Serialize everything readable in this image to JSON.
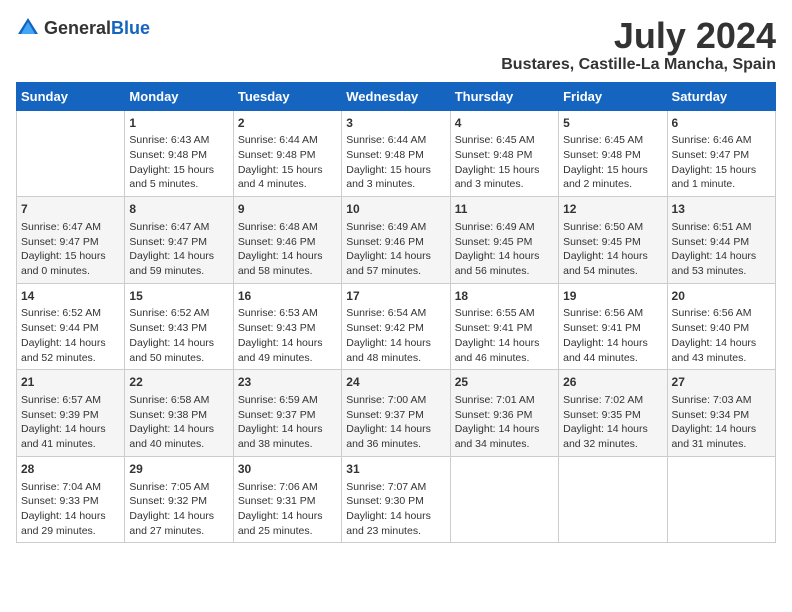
{
  "header": {
    "logo_general": "General",
    "logo_blue": "Blue",
    "month_year": "July 2024",
    "location": "Bustares, Castille-La Mancha, Spain"
  },
  "weekdays": [
    "Sunday",
    "Monday",
    "Tuesday",
    "Wednesday",
    "Thursday",
    "Friday",
    "Saturday"
  ],
  "weeks": [
    [
      {
        "day": "",
        "sunrise": "",
        "sunset": "",
        "daylight": ""
      },
      {
        "day": "1",
        "sunrise": "Sunrise: 6:43 AM",
        "sunset": "Sunset: 9:48 PM",
        "daylight": "Daylight: 15 hours and 5 minutes."
      },
      {
        "day": "2",
        "sunrise": "Sunrise: 6:44 AM",
        "sunset": "Sunset: 9:48 PM",
        "daylight": "Daylight: 15 hours and 4 minutes."
      },
      {
        "day": "3",
        "sunrise": "Sunrise: 6:44 AM",
        "sunset": "Sunset: 9:48 PM",
        "daylight": "Daylight: 15 hours and 3 minutes."
      },
      {
        "day": "4",
        "sunrise": "Sunrise: 6:45 AM",
        "sunset": "Sunset: 9:48 PM",
        "daylight": "Daylight: 15 hours and 3 minutes."
      },
      {
        "day": "5",
        "sunrise": "Sunrise: 6:45 AM",
        "sunset": "Sunset: 9:48 PM",
        "daylight": "Daylight: 15 hours and 2 minutes."
      },
      {
        "day": "6",
        "sunrise": "Sunrise: 6:46 AM",
        "sunset": "Sunset: 9:47 PM",
        "daylight": "Daylight: 15 hours and 1 minute."
      }
    ],
    [
      {
        "day": "7",
        "sunrise": "Sunrise: 6:47 AM",
        "sunset": "Sunset: 9:47 PM",
        "daylight": "Daylight: 15 hours and 0 minutes."
      },
      {
        "day": "8",
        "sunrise": "Sunrise: 6:47 AM",
        "sunset": "Sunset: 9:47 PM",
        "daylight": "Daylight: 14 hours and 59 minutes."
      },
      {
        "day": "9",
        "sunrise": "Sunrise: 6:48 AM",
        "sunset": "Sunset: 9:46 PM",
        "daylight": "Daylight: 14 hours and 58 minutes."
      },
      {
        "day": "10",
        "sunrise": "Sunrise: 6:49 AM",
        "sunset": "Sunset: 9:46 PM",
        "daylight": "Daylight: 14 hours and 57 minutes."
      },
      {
        "day": "11",
        "sunrise": "Sunrise: 6:49 AM",
        "sunset": "Sunset: 9:45 PM",
        "daylight": "Daylight: 14 hours and 56 minutes."
      },
      {
        "day": "12",
        "sunrise": "Sunrise: 6:50 AM",
        "sunset": "Sunset: 9:45 PM",
        "daylight": "Daylight: 14 hours and 54 minutes."
      },
      {
        "day": "13",
        "sunrise": "Sunrise: 6:51 AM",
        "sunset": "Sunset: 9:44 PM",
        "daylight": "Daylight: 14 hours and 53 minutes."
      }
    ],
    [
      {
        "day": "14",
        "sunrise": "Sunrise: 6:52 AM",
        "sunset": "Sunset: 9:44 PM",
        "daylight": "Daylight: 14 hours and 52 minutes."
      },
      {
        "day": "15",
        "sunrise": "Sunrise: 6:52 AM",
        "sunset": "Sunset: 9:43 PM",
        "daylight": "Daylight: 14 hours and 50 minutes."
      },
      {
        "day": "16",
        "sunrise": "Sunrise: 6:53 AM",
        "sunset": "Sunset: 9:43 PM",
        "daylight": "Daylight: 14 hours and 49 minutes."
      },
      {
        "day": "17",
        "sunrise": "Sunrise: 6:54 AM",
        "sunset": "Sunset: 9:42 PM",
        "daylight": "Daylight: 14 hours and 48 minutes."
      },
      {
        "day": "18",
        "sunrise": "Sunrise: 6:55 AM",
        "sunset": "Sunset: 9:41 PM",
        "daylight": "Daylight: 14 hours and 46 minutes."
      },
      {
        "day": "19",
        "sunrise": "Sunrise: 6:56 AM",
        "sunset": "Sunset: 9:41 PM",
        "daylight": "Daylight: 14 hours and 44 minutes."
      },
      {
        "day": "20",
        "sunrise": "Sunrise: 6:56 AM",
        "sunset": "Sunset: 9:40 PM",
        "daylight": "Daylight: 14 hours and 43 minutes."
      }
    ],
    [
      {
        "day": "21",
        "sunrise": "Sunrise: 6:57 AM",
        "sunset": "Sunset: 9:39 PM",
        "daylight": "Daylight: 14 hours and 41 minutes."
      },
      {
        "day": "22",
        "sunrise": "Sunrise: 6:58 AM",
        "sunset": "Sunset: 9:38 PM",
        "daylight": "Daylight: 14 hours and 40 minutes."
      },
      {
        "day": "23",
        "sunrise": "Sunrise: 6:59 AM",
        "sunset": "Sunset: 9:37 PM",
        "daylight": "Daylight: 14 hours and 38 minutes."
      },
      {
        "day": "24",
        "sunrise": "Sunrise: 7:00 AM",
        "sunset": "Sunset: 9:37 PM",
        "daylight": "Daylight: 14 hours and 36 minutes."
      },
      {
        "day": "25",
        "sunrise": "Sunrise: 7:01 AM",
        "sunset": "Sunset: 9:36 PM",
        "daylight": "Daylight: 14 hours and 34 minutes."
      },
      {
        "day": "26",
        "sunrise": "Sunrise: 7:02 AM",
        "sunset": "Sunset: 9:35 PM",
        "daylight": "Daylight: 14 hours and 32 minutes."
      },
      {
        "day": "27",
        "sunrise": "Sunrise: 7:03 AM",
        "sunset": "Sunset: 9:34 PM",
        "daylight": "Daylight: 14 hours and 31 minutes."
      }
    ],
    [
      {
        "day": "28",
        "sunrise": "Sunrise: 7:04 AM",
        "sunset": "Sunset: 9:33 PM",
        "daylight": "Daylight: 14 hours and 29 minutes."
      },
      {
        "day": "29",
        "sunrise": "Sunrise: 7:05 AM",
        "sunset": "Sunset: 9:32 PM",
        "daylight": "Daylight: 14 hours and 27 minutes."
      },
      {
        "day": "30",
        "sunrise": "Sunrise: 7:06 AM",
        "sunset": "Sunset: 9:31 PM",
        "daylight": "Daylight: 14 hours and 25 minutes."
      },
      {
        "day": "31",
        "sunrise": "Sunrise: 7:07 AM",
        "sunset": "Sunset: 9:30 PM",
        "daylight": "Daylight: 14 hours and 23 minutes."
      },
      {
        "day": "",
        "sunrise": "",
        "sunset": "",
        "daylight": ""
      },
      {
        "day": "",
        "sunrise": "",
        "sunset": "",
        "daylight": ""
      },
      {
        "day": "",
        "sunrise": "",
        "sunset": "",
        "daylight": ""
      }
    ]
  ]
}
